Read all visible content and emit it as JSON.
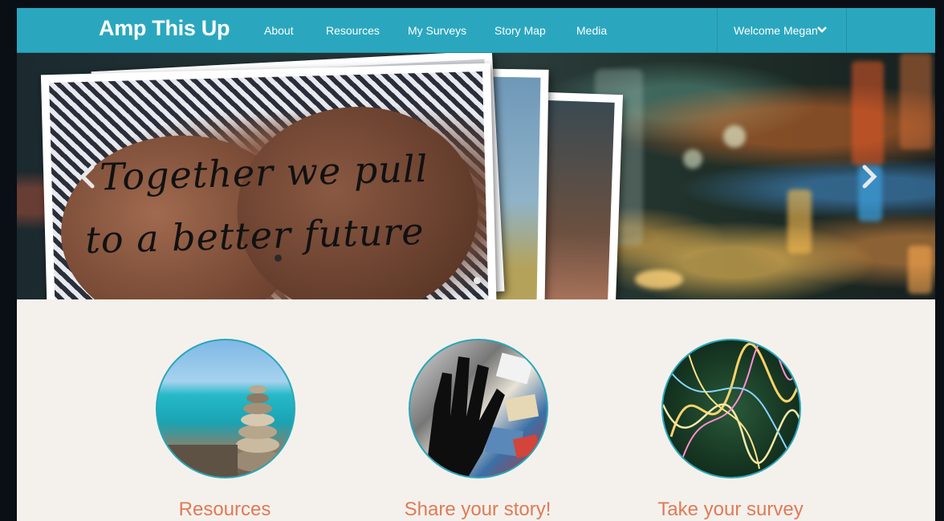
{
  "nav": {
    "brand": "Amp This Up",
    "items": [
      {
        "label": "About"
      },
      {
        "label": "Resources"
      },
      {
        "label": "My Surveys"
      },
      {
        "label": "Story Map"
      },
      {
        "label": "Media"
      }
    ],
    "welcome": "Welcome Megan",
    "welcome_icon": "chevron-down-icon"
  },
  "hero": {
    "handwriting_line1": "Together   we pull",
    "handwriting_line2": "to a better future",
    "prev_icon": "chevron-left-icon",
    "next_icon": "chevron-right-icon"
  },
  "features": [
    {
      "label": "Resources"
    },
    {
      "label": "Share your story!"
    },
    {
      "label": "Take your survey"
    }
  ],
  "colors": {
    "navbar": "#2aa7be",
    "feature_label": "#e07a57",
    "circle_border": "#29a6b8",
    "page_bg": "#f4f1ec"
  }
}
